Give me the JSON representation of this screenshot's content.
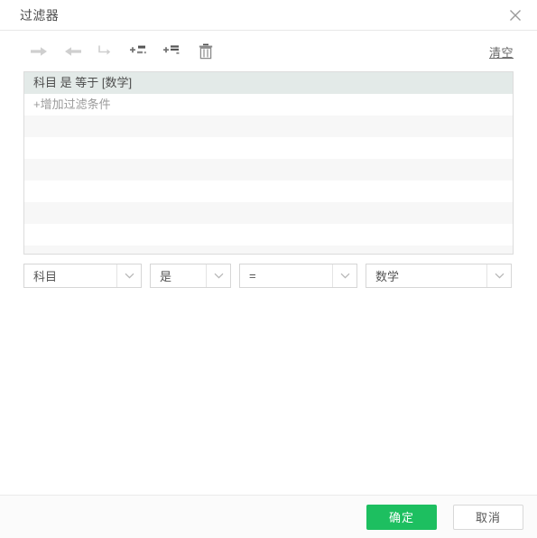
{
  "window": {
    "title": "过滤器",
    "close_icon": "close-icon"
  },
  "toolbar": {
    "buttons": [
      {
        "name": "move-right-button",
        "icon": "arrow-right-icon",
        "label": ""
      },
      {
        "name": "move-left-button",
        "icon": "arrow-left-icon",
        "label": ""
      },
      {
        "name": "undo-button",
        "icon": "undo-arrow-icon",
        "label": ""
      },
      {
        "name": "add-condition-button",
        "icon": "add-condition-icon",
        "label": ""
      },
      {
        "name": "add-group-button",
        "icon": "add-group-icon",
        "label": ""
      },
      {
        "name": "delete-button",
        "icon": "trash-icon",
        "label": ""
      }
    ],
    "clear_label": "清空"
  },
  "condition_list": {
    "selected_condition": "科目 是 等于 [数学]",
    "add_condition_label": "+增加过滤条件",
    "empty_row_count": 7
  },
  "editor": {
    "field_select": {
      "value": "科目",
      "placeholder": "科目"
    },
    "match_select": {
      "value": "是",
      "placeholder": "是"
    },
    "operator_select": {
      "value": "=",
      "placeholder": "="
    },
    "value_select": {
      "value": "数学",
      "placeholder": "数学"
    }
  },
  "footer": {
    "confirm_label": "确定",
    "cancel_label": "取消"
  },
  "colors": {
    "primary": "#1dbf60",
    "selected_row": "#e3eae8",
    "stripe": "#f7f7f7",
    "border": "#dcdcdc"
  }
}
